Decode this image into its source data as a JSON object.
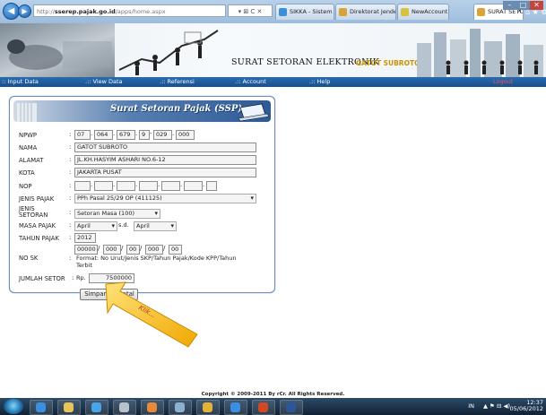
{
  "browser": {
    "url_prefix": "http://",
    "url_domain": "sserep.pajak.go.id",
    "url_path": "/apps/home.aspx",
    "addr_controls": "▾ ⊠ C ✕",
    "tabs": [
      {
        "label": "SIKKA - Sistem Inf...",
        "color": "#3a8fd8"
      },
      {
        "label": "Direktorat Jendera...",
        "color": "#d8a43a"
      },
      {
        "label": "NewAccount",
        "color": "#d8c23a"
      },
      {
        "label": "SURAT SETOR...",
        "color": "#d8a43a"
      }
    ],
    "tab_close": "✕",
    "right_icons": "⌂ ★ ⚙"
  },
  "banner": {
    "title": "SURAT SETORAN ELEKTRONIK",
    "user": "GATOT SUBROTO"
  },
  "menu": {
    "items": [
      ":: Input Data",
      ".:: View Data",
      ".:: Referensi",
      ".:: Account",
      ".:: Help"
    ],
    "logout": "Logout"
  },
  "form": {
    "title": "Surat Setoran Pajak (SSP)",
    "npwp": {
      "label": "NPWP",
      "parts": [
        "07",
        "064",
        "679",
        "9",
        "029",
        "000"
      ]
    },
    "nama": {
      "label": "NAMA",
      "value": "GATOT SUBROTO"
    },
    "alamat": {
      "label": "ALAMAT",
      "value": "JL.KH.HASYIM ASHARI NO.6-12"
    },
    "kota": {
      "label": "KOTA",
      "value": "JAKARTA PUSAT"
    },
    "nop": {
      "label": "NOP"
    },
    "jenis_pajak": {
      "label": "JENIS PAJAK",
      "value": "PPh Pasal 25/29 OP (411125)"
    },
    "jenis_setoran": {
      "label1": "JENIS",
      "label2": "SETORAN",
      "value": "Setoran Masa (100)"
    },
    "masa_pajak": {
      "label": "MASA PAJAK",
      "from": "April",
      "sep": "s.d.",
      "to": "April"
    },
    "tahun_pajak": {
      "label": "TAHUN PAJAK",
      "value": "2012"
    },
    "no_sk": {
      "label": "NO SK",
      "parts": [
        "00000",
        "000",
        "00",
        "000",
        "00"
      ],
      "format_note1": "Format: No Urut/Jenis SKP/Tahun Pajak/Kode KPP/Tahun",
      "format_note2": "Terbit"
    },
    "jumlah_setor": {
      "label": "JUMLAH SETOR",
      "currency": "Rp.",
      "value": "7500000"
    },
    "buttons": {
      "simpan": "Simpan",
      "batal": "Batal"
    }
  },
  "annotation": {
    "text": "Klik..."
  },
  "footer": {
    "text": "Copyright © 2009-2011 By rCr. All Rights Reserved."
  },
  "taskbar": {
    "lang": "IN",
    "time": "12:37",
    "date": "05/06/2012"
  }
}
